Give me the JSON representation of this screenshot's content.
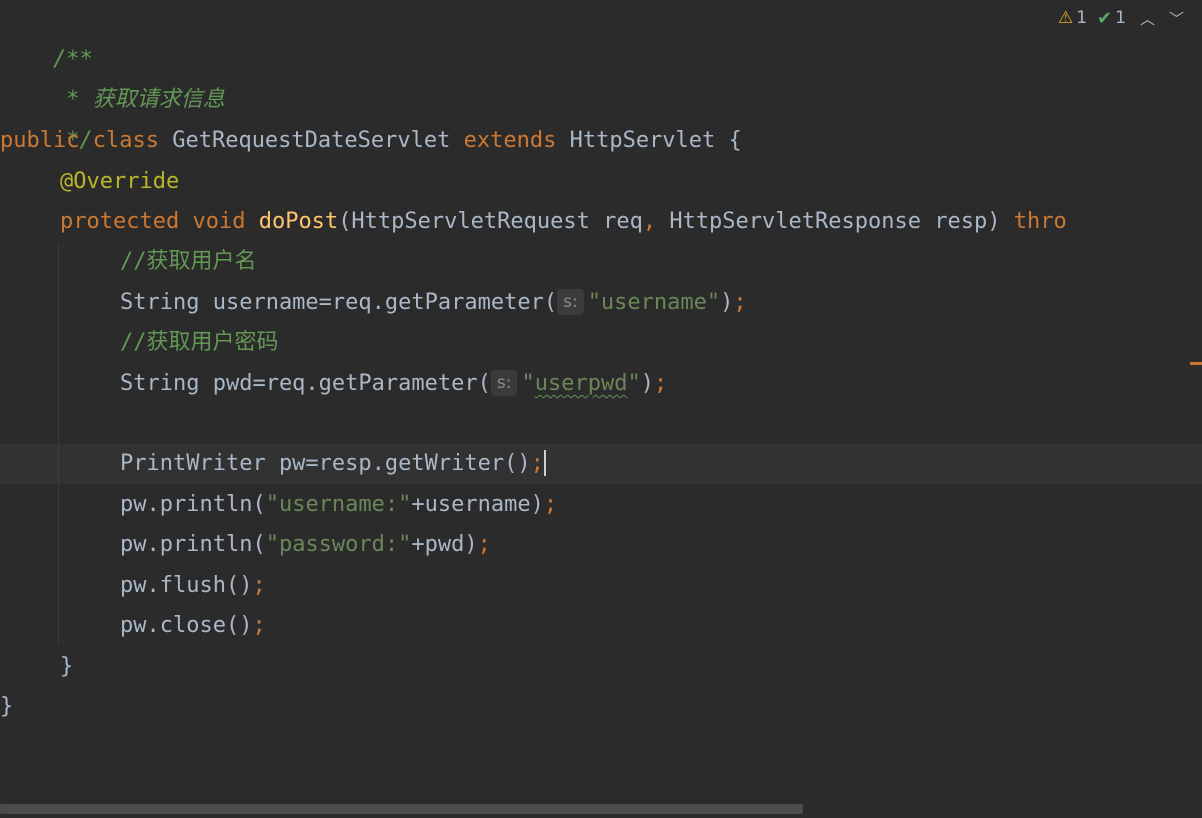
{
  "inspections": {
    "warnings_count": "1",
    "weak_warnings_count": "1",
    "warning_icon": "warning-triangle-icon",
    "check_icon": "double-check-icon"
  },
  "code": {
    "doc_open": "/**",
    "doc_line": " * 获取请求信息",
    "doc_close": " */",
    "class_kw1": "public",
    "class_kw2": "class",
    "class_name": "GetRequestDateServlet",
    "extends_kw": "extends",
    "super_class": "HttpServlet",
    "class_brace": "{",
    "annotation": "@Override",
    "method_mod": "protected",
    "method_void": "void",
    "method_name": "doPost",
    "method_params_1": "(HttpServletRequest req",
    "method_comma": ",",
    "method_params_2": " HttpServletResponse resp) ",
    "throws_kw": "thro",
    "comment_user": "//获取用户名",
    "line_user_pre": "String username=req.getParameter(",
    "hint_s1": "s:",
    "str_username": "\"username\"",
    "close_paren": ")",
    "semicolon": ";",
    "comment_pwd": "//获取用户密码",
    "line_pwd_pre": "String pwd=req.getParameter(",
    "hint_s2": "s:",
    "str_userpwd_q1": "\"",
    "str_userpwd_word": "userpwd",
    "str_userpwd_q2": "\"",
    "line_writer": "PrintWriter pw=resp.getWriter()",
    "line_println1_pre": "pw.println(",
    "str_username_label": "\"username:\"",
    "line_println1_post": "+username)",
    "line_println2_pre": "pw.println(",
    "str_password_label": "\"password:\"",
    "line_println2_post": "+pwd)",
    "line_flush": "pw.flush()",
    "line_close": "pw.close()",
    "method_close": "}",
    "class_close": "}"
  },
  "colors": {
    "background": "#2b2b2b",
    "keyword": "#cc7832",
    "string": "#6a8759",
    "comment": "#629755",
    "annotation": "#bbb529",
    "function": "#ffc66d",
    "text": "#a9b7c6"
  }
}
